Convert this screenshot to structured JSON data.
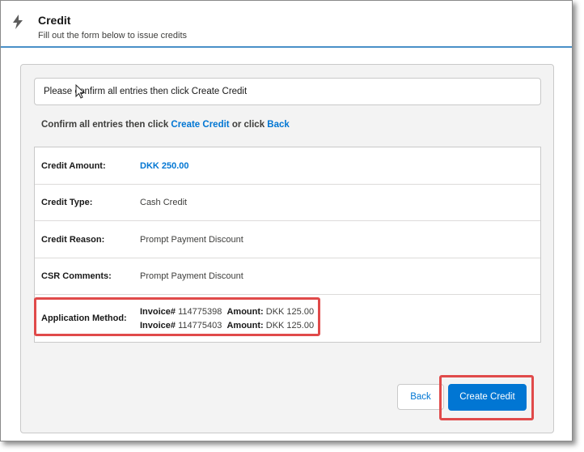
{
  "header": {
    "icon": "lightning-icon",
    "title": "Credit",
    "subtitle": "Fill out the form below to issue credits"
  },
  "notice": {
    "text": "Please confirm all entries then click Create Credit"
  },
  "confirm": {
    "prefix": "Confirm all entries then click ",
    "create_link": "Create Credit",
    "middle": " or click ",
    "back_link": "Back"
  },
  "details": {
    "credit_amount": {
      "label": "Credit Amount:",
      "value": "DKK 250.00"
    },
    "credit_type": {
      "label": "Credit Type:",
      "value": "Cash Credit"
    },
    "credit_reason": {
      "label": "Credit Reason:",
      "value": "Prompt Payment Discount"
    },
    "csr_comments": {
      "label": "CSR Comments:",
      "value": "Prompt Payment Discount"
    },
    "application_method": {
      "label": "Application Method:",
      "invoices": [
        {
          "invoice_label": "Invoice#",
          "invoice_number": "114775398",
          "amount_label": "Amount:",
          "amount": "DKK 125.00"
        },
        {
          "invoice_label": "Invoice#",
          "invoice_number": "114775403",
          "amount_label": "Amount:",
          "amount": "DKK 125.00"
        }
      ]
    }
  },
  "buttons": {
    "back_label": "Back",
    "create_label": "Create Credit"
  },
  "colors": {
    "accent": "#0176d3",
    "highlight": "#e04a4a",
    "header_rule": "#4a90c8"
  }
}
